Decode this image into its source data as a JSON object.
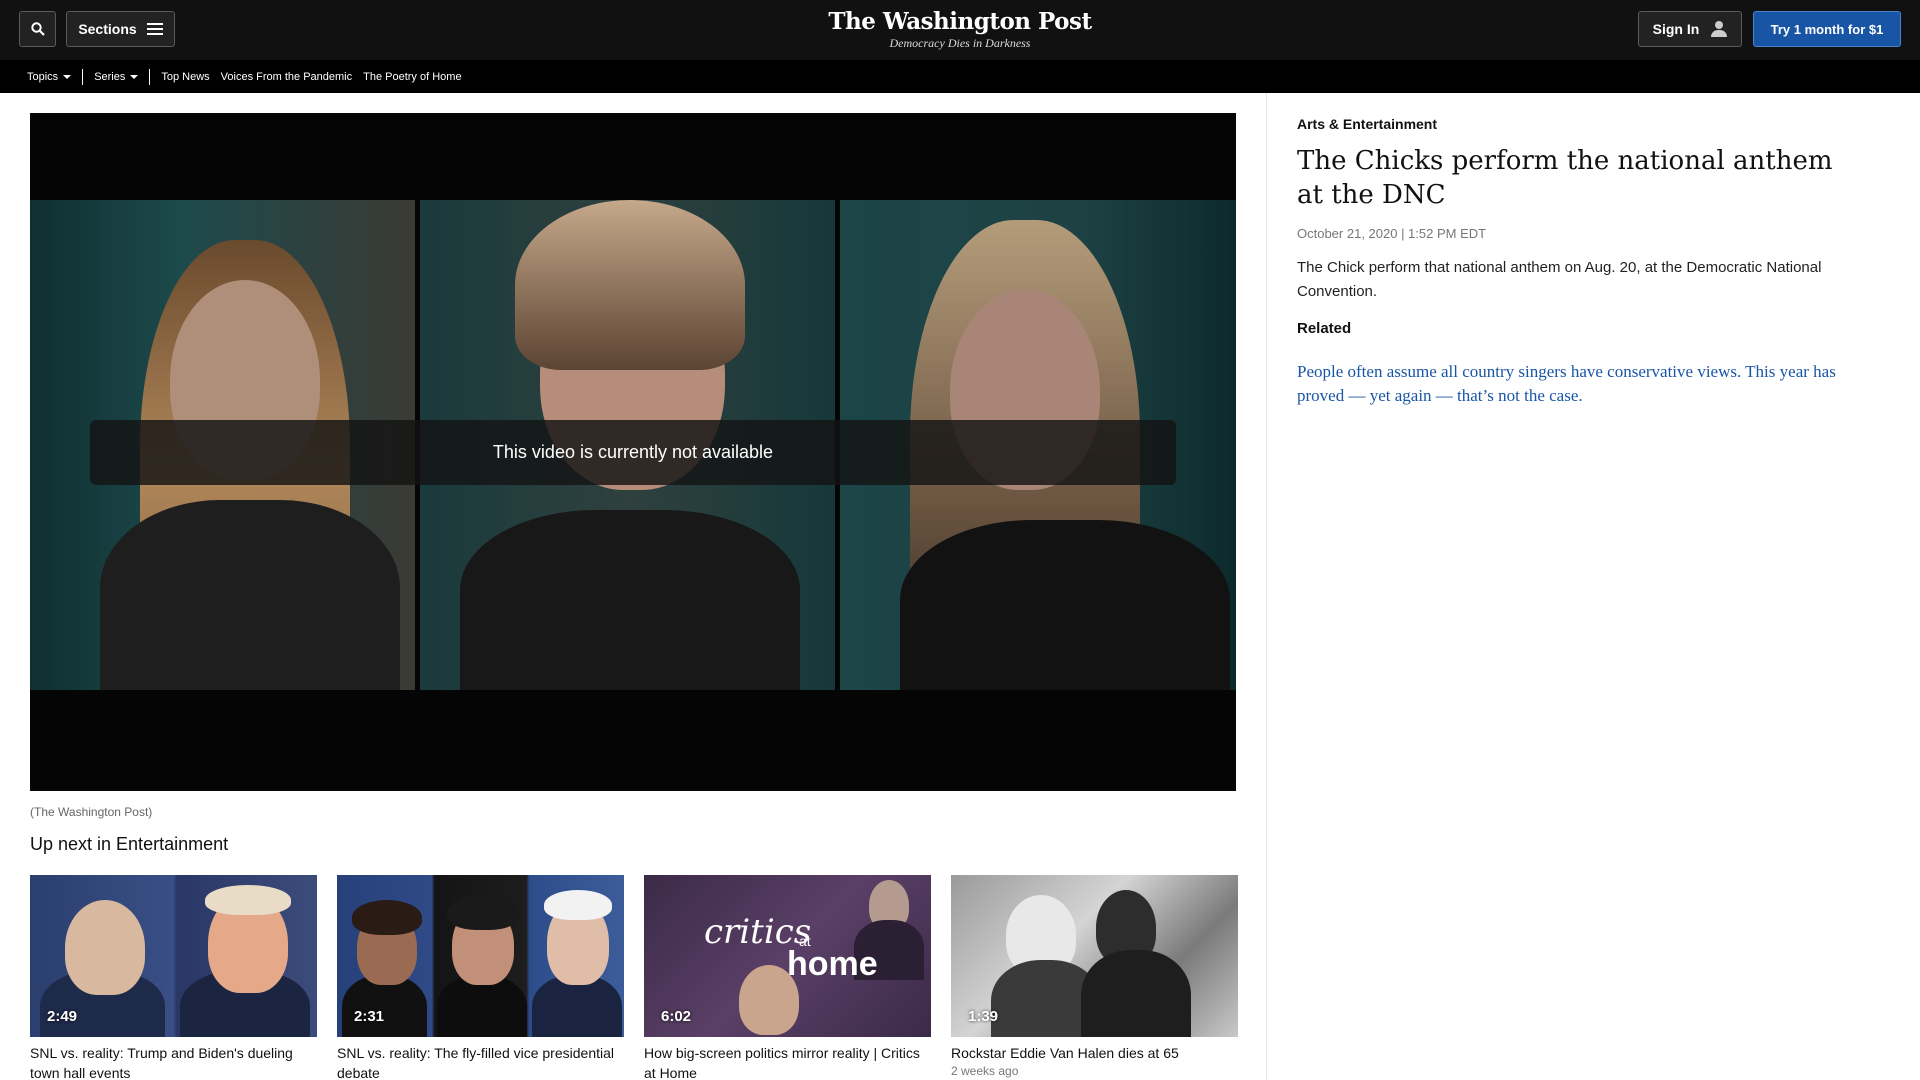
{
  "header": {
    "sections_label": "Sections",
    "masthead_title": "The Washington Post",
    "masthead_tagline": "Democracy Dies in Darkness",
    "signin_label": "Sign In",
    "subscribe_label": "Try 1 month for $1"
  },
  "subnav": {
    "items": [
      "Topics",
      "Series",
      "Top News",
      "Voices From the Pandemic",
      "The Poetry of Home"
    ]
  },
  "video": {
    "overlay_message": "This video is currently not available",
    "credit": "(The Washington Post)"
  },
  "up_next": {
    "heading": "Up next in Entertainment",
    "cards": [
      {
        "duration": "2:49",
        "title": "SNL vs. reality: Trump and Biden's dueling town hall events",
        "meta": ""
      },
      {
        "duration": "2:31",
        "title": "SNL vs. reality: The fly-filled vice presidential debate",
        "meta": ""
      },
      {
        "duration": "6:02",
        "title": "How big-screen politics mirror reality | Critics at Home",
        "meta": "",
        "thumb_text_1": "critics",
        "thumb_text_2": "at",
        "thumb_text_3": "home"
      },
      {
        "duration": "1:39",
        "title": "Rockstar Eddie Van Halen dies at 65",
        "meta": "2 weeks ago"
      }
    ]
  },
  "article": {
    "kicker": "Arts & Entertainment",
    "title": "The Chicks perform the national anthem at the DNC",
    "date": "October 21, 2020 | 1:52 PM EDT",
    "description": "The Chick perform that national anthem on Aug. 20, at the Democratic National Convention.",
    "related_heading": "Related",
    "related_link": "People often assume all country singers have conservative views. This year has proved — yet again — that’s not the case."
  },
  "colors": {
    "header_bg": "#111111",
    "subscribe_bg": "#1955a5",
    "link": "#1955a5"
  }
}
